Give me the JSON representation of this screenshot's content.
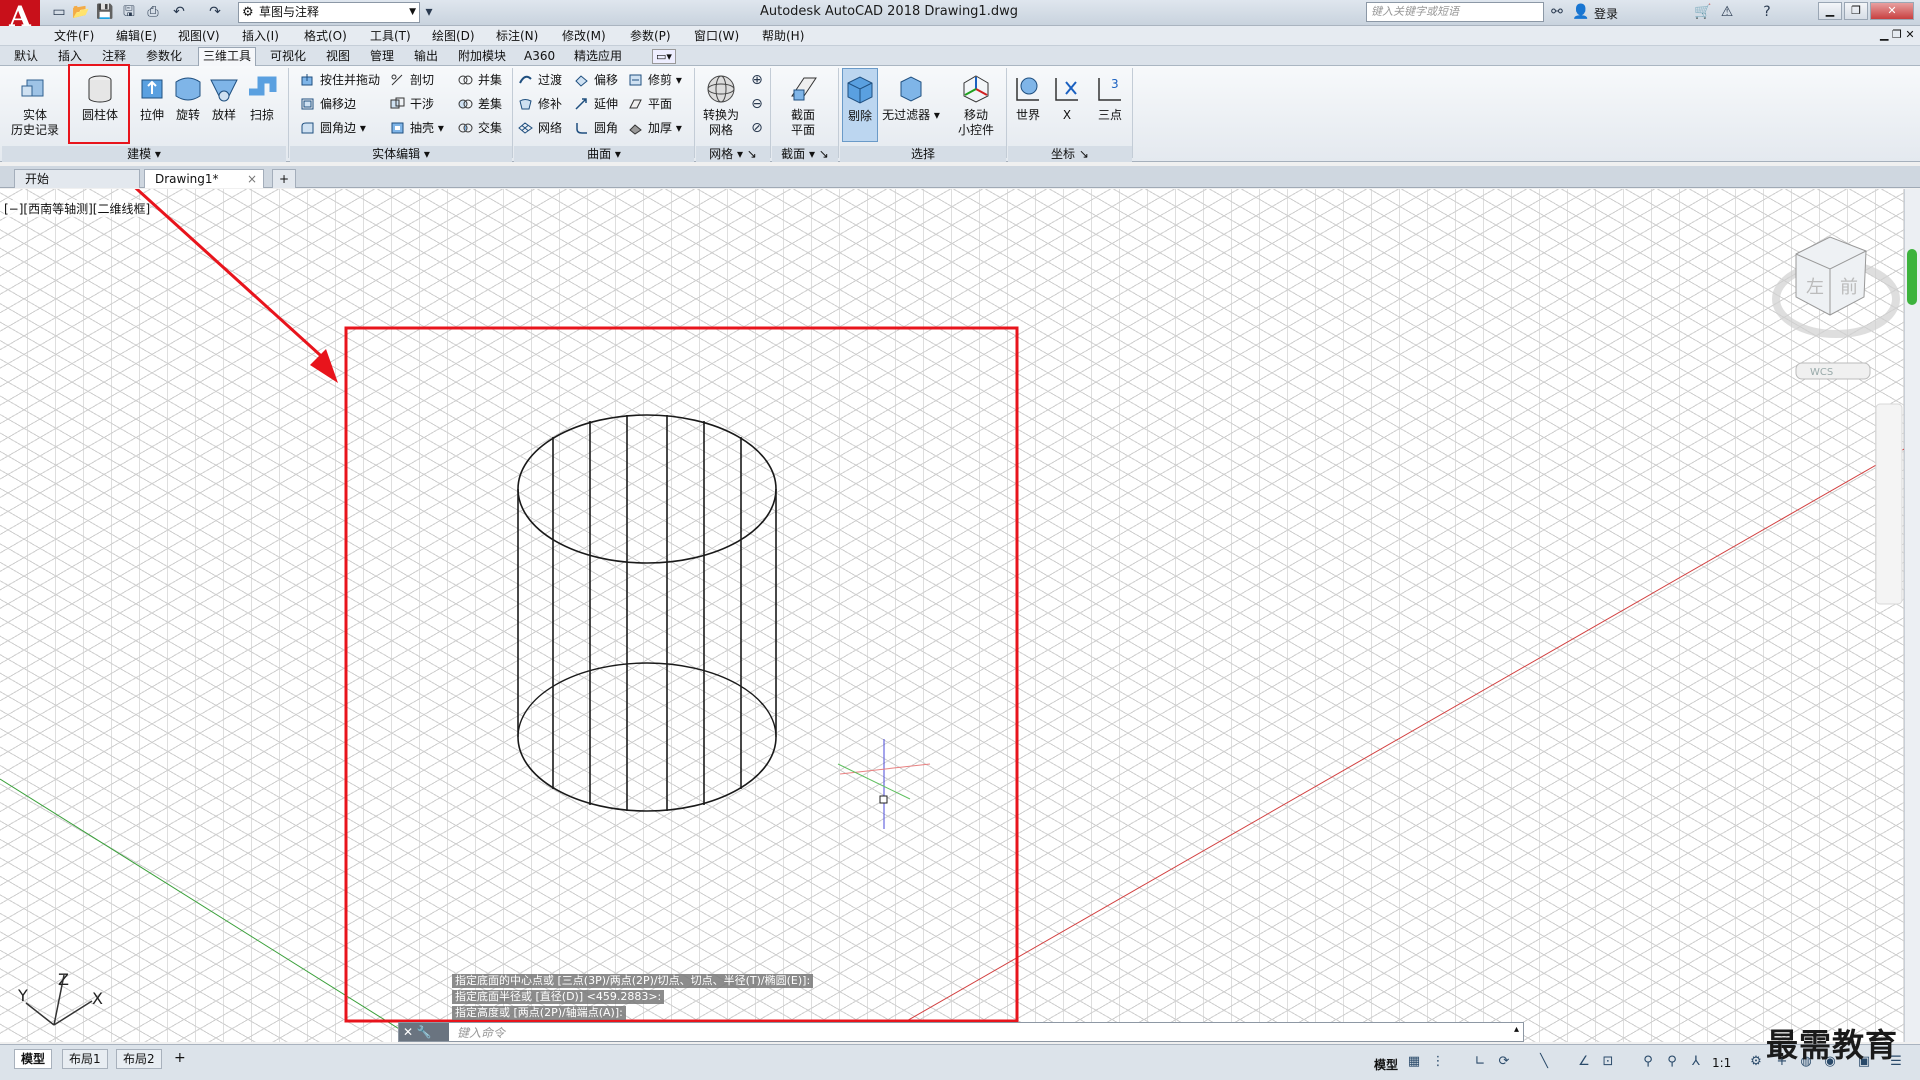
{
  "app": {
    "logo_letter": "A",
    "window_title": "Autodesk AutoCAD 2018    Drawing1.dwg",
    "workspace": "草图与注释",
    "search_placeholder": "键入关键字或短语",
    "login_label": "登录",
    "colors": {
      "accent_red": "#e8141c",
      "logo_red": "#c8101a",
      "ribbon_bg": "#eef2f6"
    }
  },
  "menu": {
    "items": [
      "文件(F)",
      "编辑(E)",
      "视图(V)",
      "插入(I)",
      "格式(O)",
      "工具(T)",
      "绘图(D)",
      "标注(N)",
      "修改(M)",
      "参数(P)",
      "窗口(W)",
      "帮助(H)"
    ]
  },
  "ribbon_tabs": {
    "items": [
      "默认",
      "插入",
      "注释",
      "参数化",
      "三维工具",
      "可视化",
      "视图",
      "管理",
      "输出",
      "附加模块",
      "A360",
      "精选应用"
    ],
    "active_index": 4
  },
  "ribbon": {
    "modeling": {
      "title": "建模",
      "history": "实体\n历史记录",
      "cylinder": "圆柱体",
      "extrude": "拉伸",
      "revolve": "旋转",
      "loft": "放样",
      "sweep": "扫掠"
    },
    "solid_edit": {
      "title": "实体编辑",
      "items": [
        "按住并拖动",
        "偏移边",
        "圆角边",
        "剖切",
        "干涉",
        "抽壳",
        "并集",
        "差集",
        "交集"
      ]
    },
    "surface": {
      "title": "曲面",
      "items": [
        "过渡",
        "修补",
        "网络",
        "偏移",
        "延伸",
        "圆角",
        "修剪",
        "平面",
        "加厚"
      ]
    },
    "mesh": {
      "title": "网格",
      "convert": "转换为\n网格"
    },
    "section": {
      "title": "截面",
      "plane": "截面\n平面"
    },
    "selection": {
      "title": "选择",
      "cull": "剔除",
      "no_filter": "无过滤器",
      "move_gizmo": "移动\n小控件"
    },
    "coordinates": {
      "title": "坐标",
      "world": "世界",
      "x": "X",
      "three_point": "三点"
    }
  },
  "file_tabs": {
    "start": "开始",
    "drawing": "Drawing1*",
    "close": "×",
    "add": "+"
  },
  "viewport": {
    "label": "[−][西南等轴测][二维线框]",
    "ucs_x": "X",
    "ucs_y": "Y",
    "ucs_z": "Z",
    "viewcube_left": "左",
    "viewcube_front": "前",
    "viewcube_wcs": "WCS"
  },
  "command": {
    "history": [
      "指定底面的中心点或 [三点(3P)/两点(2P)/切点、切点、半径(T)/椭圆(E)]:",
      "指定底面半径或 [直径(D)] <459.2883>:",
      "指定高度或 [两点(2P)/轴端点(A)]:"
    ],
    "input_placeholder": "键入命令",
    "close_label": "✕"
  },
  "status": {
    "layout_tabs": [
      "模型",
      "布局1",
      "布局2"
    ],
    "add_tab": "+",
    "model_label": "模型",
    "scale": "1:1"
  },
  "watermark": "最需教育"
}
